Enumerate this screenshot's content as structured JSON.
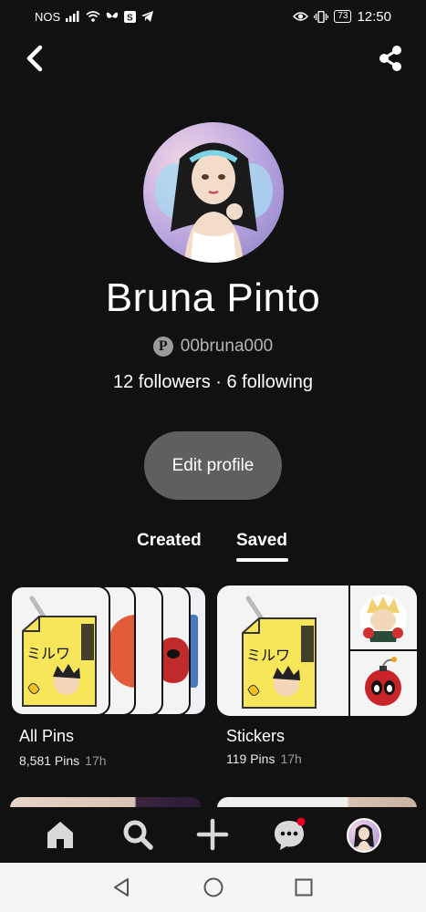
{
  "status_bar": {
    "carrier": "NOS",
    "signal": "▎▎▎▎",
    "battery": "73",
    "time": "12:50"
  },
  "profile": {
    "name": "Bruna Pinto",
    "handle": "00bruna000",
    "followers": "12 followers",
    "separator": " · ",
    "following": "6 following",
    "edit_label": "Edit profile"
  },
  "tabs": {
    "created": "Created",
    "saved": "Saved",
    "active": "saved"
  },
  "boards": [
    {
      "title": "All Pins",
      "count": "8,581 Pins",
      "age": "17h"
    },
    {
      "title": "Stickers",
      "count": "119 Pins",
      "age": "17h"
    }
  ],
  "sticker_text": "ミルワ",
  "colors": {
    "background": "#111111",
    "button": "#5f5f5f",
    "notification_dot": "#e60023"
  },
  "icons": {
    "back": "chevron-left-icon",
    "share": "share-icon",
    "home": "home-icon",
    "search": "search-icon",
    "create": "plus-icon",
    "messages": "chat-bubble-icon",
    "profile": "avatar"
  }
}
